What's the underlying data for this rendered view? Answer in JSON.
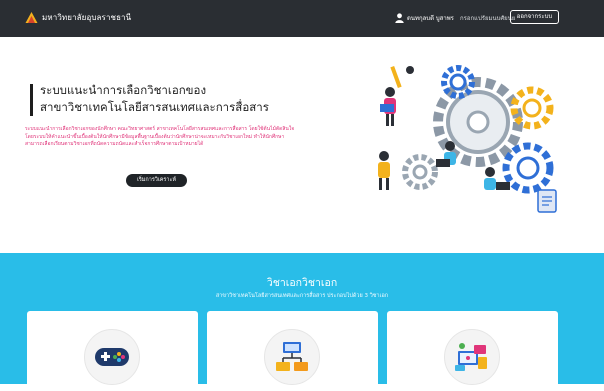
{
  "navbar": {
    "brand_name": "มหาวิทยาลัยอุบลราชธานี",
    "user_name": "ดนทกุลบดี บูสาพร",
    "profile_link": "กรอกแปรัยมนบศัยนย",
    "logout_label": "ออกจากระบบ"
  },
  "hero": {
    "title_line1": "ระบบแนะนำการเลือกวิชาเอกของ",
    "title_line2": "สาขาวิชาเทคโนโลยีสารสนเทศและการสื่อสาร",
    "description": "ระบบแนะนำการเลือกวิชาเอกของนักศึกษา คณะวิทยาศาสตร์ สาขาเทคโนโลยีสารสนเทศและการสื่อสาร โดยใช้ต้นไม้ตัดสินใจโดยระบบให้คำแนะนำขึ้นเบื้องต้นให้นักศึกษามีข้อมูลพื้นฐานเบื้องต้นว่านักศึกษาน่าจะเหมาะกับวิชาเอกใหม่ ทำให้นักศึกษาสามารถเลือกเรียนตามวิชาเอกที่ถนัดความถนัดและสำเร็จการศึกษาตามเป้าหมายได้",
    "button_label": "เริ่มการวิเคราะห์"
  },
  "majors": {
    "title": "วิชาเอกวิชาเอก",
    "subtitle": "สาขาวิชาเทคโนโลยีสารสนเทศและการสื่อสาร ประกอบไปด้วย 3 วิชาเอก",
    "cards": [
      {
        "icon": "gamepad-icon"
      },
      {
        "icon": "network-icon"
      },
      {
        "icon": "multimedia-icon"
      }
    ]
  },
  "colors": {
    "navbar_bg": "#2a2e33",
    "accent_pink": "#e0357a",
    "section_blue": "#29bde8",
    "button_dark": "#1f2327"
  }
}
